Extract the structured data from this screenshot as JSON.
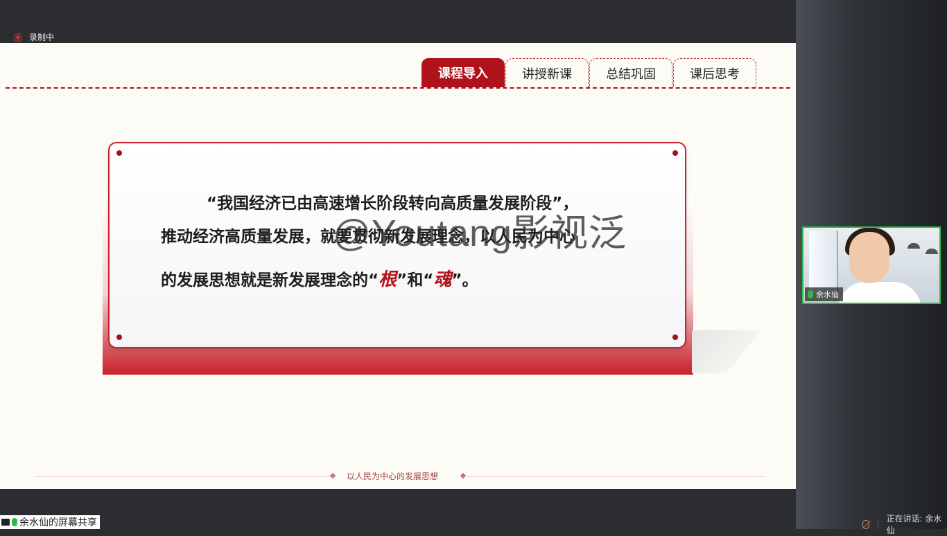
{
  "recording": {
    "label": "录制中"
  },
  "tabs": [
    {
      "label": "课程导入",
      "active": true
    },
    {
      "label": "讲授新课",
      "active": false
    },
    {
      "label": "总结巩固",
      "active": false
    },
    {
      "label": "课后思考",
      "active": false
    }
  ],
  "quote": {
    "line1": "“我国经济已由高速增长阶段转向高质量发展阶段”，",
    "line2": "推动经济高质量发展，就要贯彻新发展理念，以人民为中心",
    "line3_pre": "的发展思想就是新发展理念的“",
    "hl1": "根",
    "line3_mid": "”和“",
    "hl2": "魂",
    "line3_post": "”。"
  },
  "watermark": "@Youtang影视泛",
  "footer": {
    "title": "以人民为中心的发展思想"
  },
  "screen_share": {
    "label": "余水仙的屏幕共享"
  },
  "video": {
    "name": "余水仙"
  },
  "speaking": {
    "label": "正在讲话: 余水仙"
  },
  "colors": {
    "accent": "#b0121b",
    "speaking_border": "#2fbf47"
  }
}
